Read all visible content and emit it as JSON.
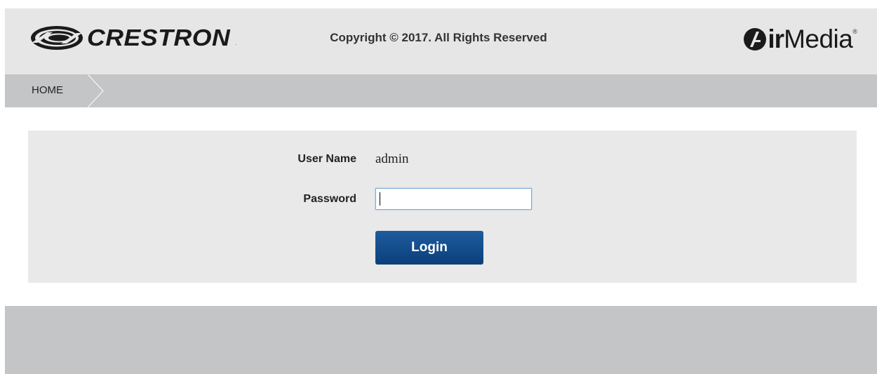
{
  "header": {
    "brand_logo_text": "CRESTRON",
    "brand_logo_tm": ".",
    "product_logo_ir": "ir",
    "product_logo_media": "Media",
    "product_logo_reg": "®",
    "background": "#e6e6e6"
  },
  "breadcrumb": {
    "items": [
      {
        "label": "HOME"
      }
    ],
    "background": "#c4c5c6"
  },
  "login": {
    "username_label": "User Name",
    "username_value": "admin",
    "password_label": "Password",
    "password_value": "",
    "submit_label": "Login",
    "button_color": "#0b3f7a",
    "input_focus_border": "#7ea7d8",
    "panel_background": "#e9e9e9"
  },
  "footer": {
    "copyright": "Copyright © 2017. All Rights Reserved",
    "background": "#c4c5c6"
  },
  "icons": {
    "brand": "crestron-swirl-icon",
    "product": "airmedia-mark-icon",
    "breadcrumb_separator": "chevron-right-icon"
  }
}
